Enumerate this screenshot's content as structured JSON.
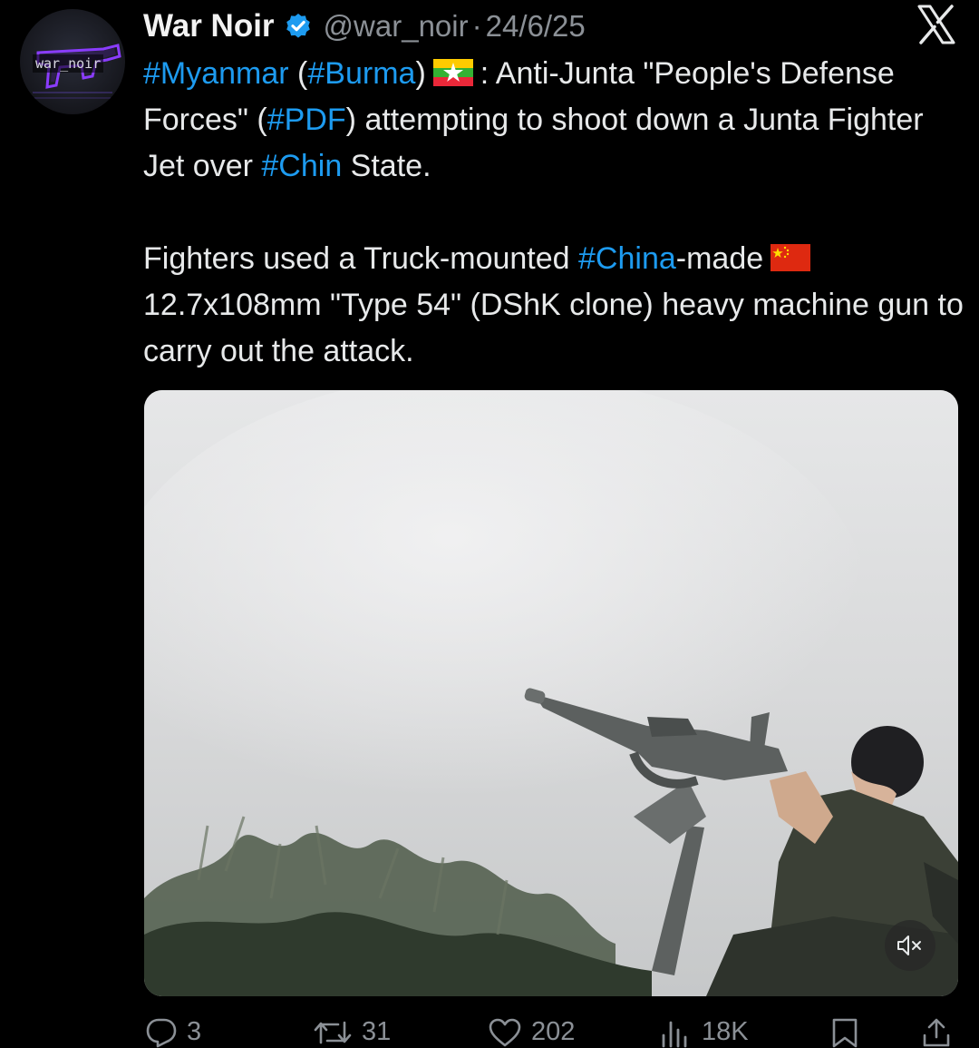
{
  "author": {
    "name": "War Noir",
    "handle": "@war_noir",
    "separator": "·",
    "date": "24/6/25",
    "avatar_label": "war_noir"
  },
  "tweet": {
    "p1": [
      {
        "t": "#Myanmar",
        "tag": true
      },
      {
        "t": " (",
        "tag": false
      },
      {
        "t": "#Burma",
        "tag": true
      },
      {
        "t": ")",
        "tag": false
      },
      {
        "flag": "myanmar"
      },
      {
        "t": ": Anti-Junta \"People's Defense Forces\" (",
        "tag": false
      },
      {
        "t": "#PDF",
        "tag": true
      },
      {
        "t": ") attempting to shoot down a Junta Fighter Jet over ",
        "tag": false
      },
      {
        "t": "#Chin",
        "tag": true
      },
      {
        "t": " State.",
        "tag": false
      }
    ],
    "p2": [
      {
        "t": "Fighters used a Truck-mounted ",
        "tag": false
      },
      {
        "t": "#China",
        "tag": true
      },
      {
        "t": "-made",
        "tag": false
      },
      {
        "flag": "china"
      },
      {
        "t": "12.7x108mm \"Type 54\" (DShK clone)  heavy machine gun to carry out the attack.",
        "tag": false
      }
    ]
  },
  "actions": {
    "replies": "3",
    "reposts": "31",
    "likes": "202",
    "views": "18K"
  },
  "icons": {
    "verified": "verified-badge-icon",
    "logo": "x-logo-icon",
    "mute": "volume-muted-icon",
    "reply": "reply-bubble-icon",
    "repost": "repost-icon",
    "like": "heart-icon",
    "views": "views-bar-icon",
    "bookmark": "bookmark-icon",
    "share": "share-icon"
  },
  "colors": {
    "background": "#000000",
    "text": "#e7e9ea",
    "secondary": "#8b9096",
    "hashtag": "#1d9bf0",
    "verified": "#1d9bf0"
  }
}
